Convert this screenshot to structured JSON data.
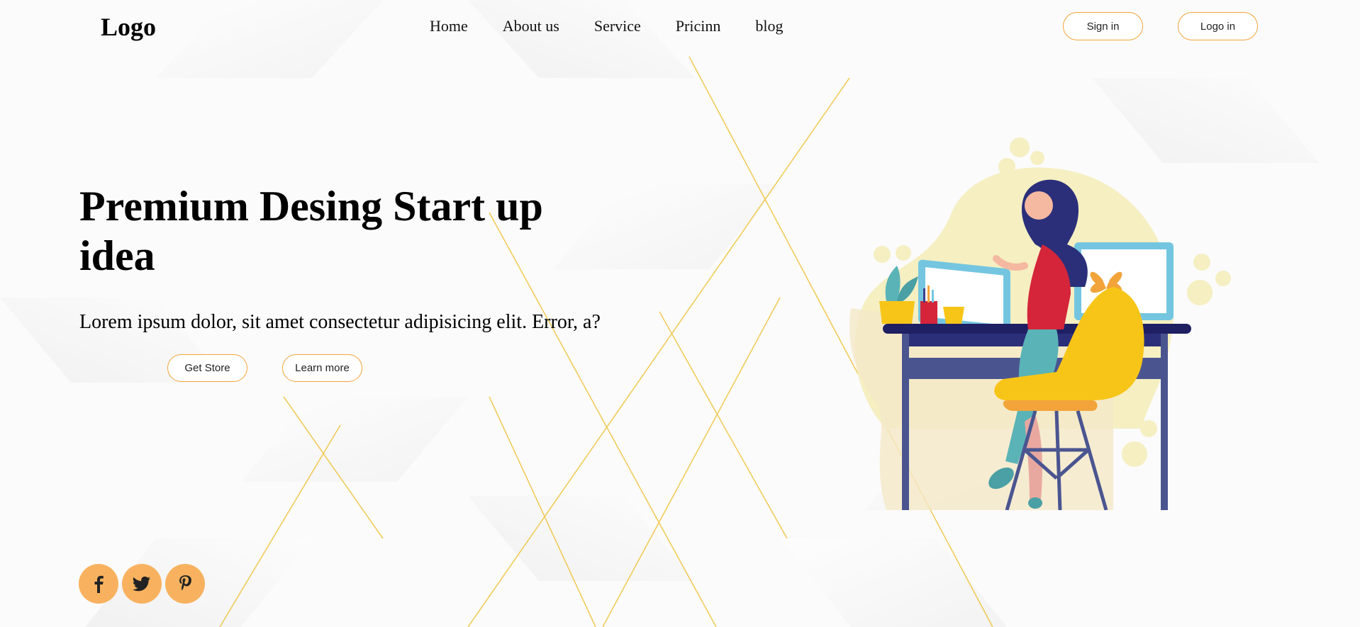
{
  "header": {
    "logo": "Logo",
    "nav": [
      {
        "label": "Home"
      },
      {
        "label": "About us"
      },
      {
        "label": "Service"
      },
      {
        "label": "Pricinn"
      },
      {
        "label": "blog"
      }
    ],
    "sign_in_label": "Sign in",
    "log_in_label": "Logo in"
  },
  "hero": {
    "title": "Premium Desing Start up idea",
    "text": "Lorem ipsum dolor, sit amet consectetur adipisicing elit. Error, a?",
    "get_store_label": "Get Store",
    "learn_more_label": "Learn more"
  },
  "social": [
    {
      "icon": "facebook-icon"
    },
    {
      "icon": "twitter-icon"
    },
    {
      "icon": "pinterest-icon"
    }
  ],
  "colors": {
    "accent": "#f2a43a",
    "social_bg": "#f8b25f",
    "gold_line": "#f0c74a",
    "text": "#000000"
  }
}
